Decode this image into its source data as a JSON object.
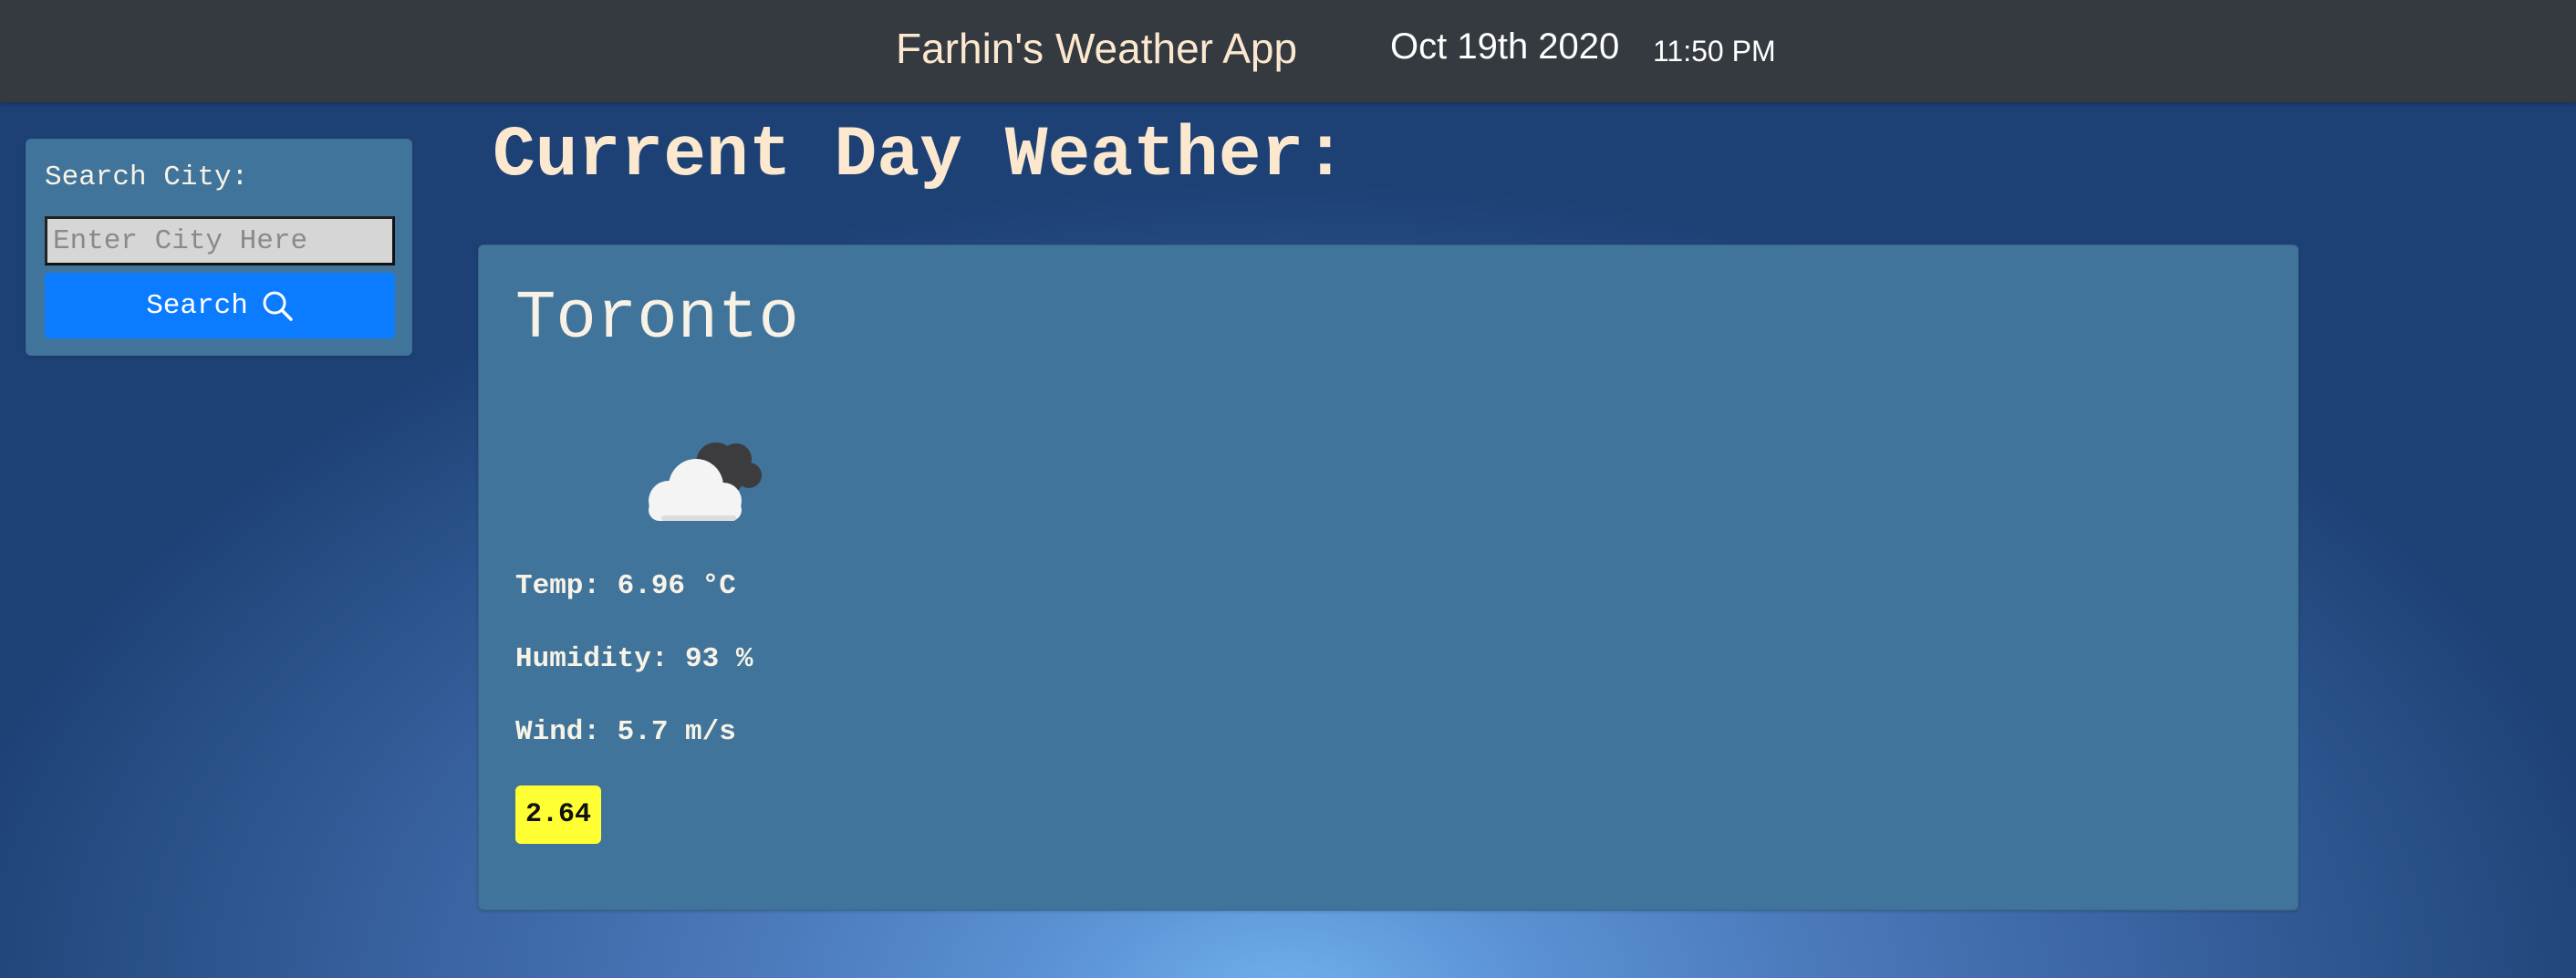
{
  "header": {
    "app_title": "Farhin's Weather App",
    "date": "Oct 19th 2020",
    "time": "11:50 PM"
  },
  "search": {
    "label": "Search City:",
    "placeholder": "Enter City Here",
    "value": "",
    "button_label": "Search",
    "button_icon": "search-icon"
  },
  "current": {
    "heading": "Current Day Weather:",
    "city": "Toronto",
    "icon": "cloudy-icon",
    "temp_label": "Temp:",
    "temp_value": "6.96",
    "temp_unit": "°C",
    "humidity_label": "Humidity:",
    "humidity_value": "93",
    "humidity_unit": "%",
    "wind_label": "Wind:",
    "wind_value": "5.7",
    "wind_unit": "m/s",
    "uv_index": "2.64"
  },
  "colors": {
    "topbar": "#343a40",
    "title_text": "#fce8cf",
    "card_bg": "#41749a",
    "button_bg": "#0b7bff",
    "uv_badge_bg": "#ffff33"
  }
}
